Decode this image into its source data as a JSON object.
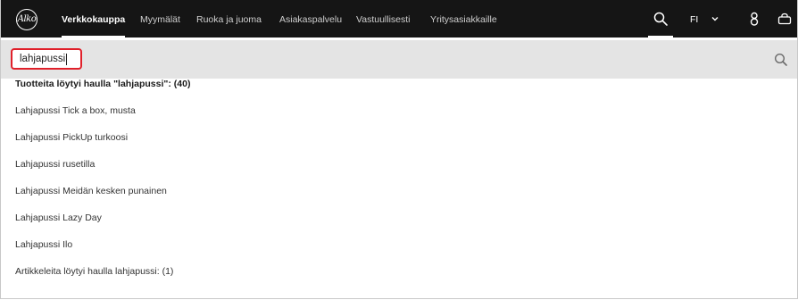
{
  "brand": {
    "logo_text": "Alko"
  },
  "nav": {
    "items": [
      "Verkkokauppa",
      "Myymälät",
      "Ruoka ja juoma",
      "Asiakaspalvelu",
      "Vastuullisesti",
      "Yritysasiakkaille"
    ],
    "active": "Verkkokauppa"
  },
  "header_icons": {
    "search": "search-icon",
    "language": "FI",
    "language_chevron": "chevron-down-icon",
    "account": "user-icon",
    "cart": "basket-icon"
  },
  "search": {
    "value": "lahjapussi",
    "button_icon": "search-icon"
  },
  "results": {
    "products_heading": "Tuotteita löytyi haulla \"lahjapussi\": (40)",
    "products": [
      "Lahjapussi Tick a box, musta",
      "Lahjapussi PickUp turkoosi",
      "Lahjapussi rusetilla",
      "Lahjapussi Meidän kesken punainen",
      "Lahjapussi Lazy Day",
      "Lahjapussi Ilo"
    ],
    "articles_heading": "Artikkeleita löytyi haulla lahjapussi: (1)"
  },
  "colors": {
    "topbar": "#151515",
    "searchbar": "#e4e4e4",
    "focus_outline": "#e0202a"
  }
}
